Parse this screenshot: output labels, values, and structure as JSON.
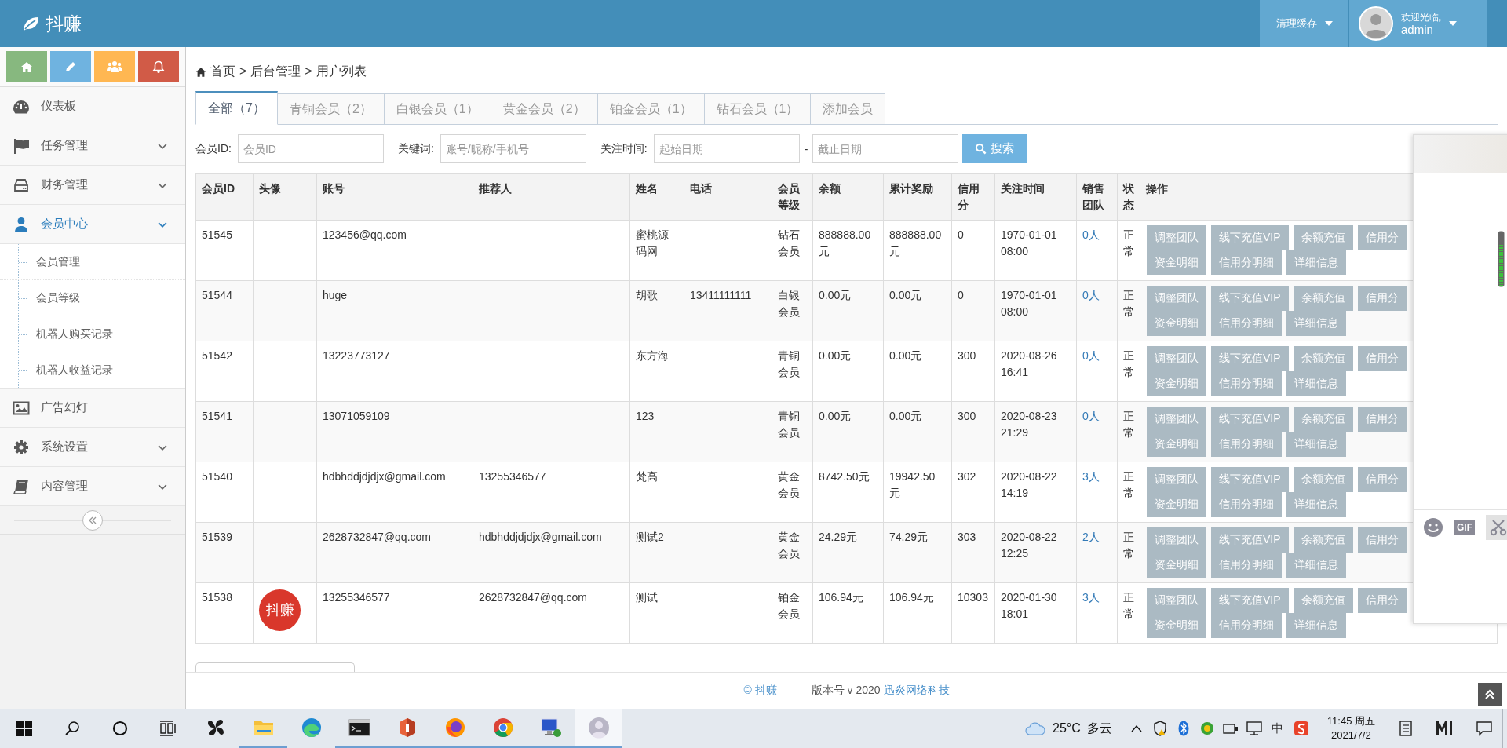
{
  "header": {
    "logo": "抖赚",
    "clear_cache": "清理缓存",
    "welcome": "欢迎光临,",
    "username": "admin"
  },
  "sidebar": {
    "items": [
      {
        "label": "仪表板",
        "selected": false,
        "submenu": false
      },
      {
        "label": "任务管理",
        "selected": false,
        "submenu": true
      },
      {
        "label": "财务管理",
        "selected": false,
        "submenu": true
      },
      {
        "label": "会员中心",
        "selected": true,
        "submenu": true,
        "children": [
          {
            "label": "会员管理",
            "selected": false
          },
          {
            "label": "会员等级",
            "selected": false
          },
          {
            "label": "机器人购买记录",
            "selected": false
          },
          {
            "label": "机器人收益记录",
            "selected": false
          }
        ]
      },
      {
        "label": "广告幻灯",
        "selected": false,
        "submenu": false
      },
      {
        "label": "系统设置",
        "selected": false,
        "submenu": true
      },
      {
        "label": "内容管理",
        "selected": false,
        "submenu": true
      }
    ]
  },
  "breadcrumb": {
    "items": [
      "首页",
      "后台管理",
      "用户列表"
    ],
    "separators": [
      ">",
      ">"
    ]
  },
  "tabs": [
    {
      "label": "全部（7）",
      "selected": true
    },
    {
      "label": "青铜会员（2）",
      "selected": false
    },
    {
      "label": "白银会员（1）",
      "selected": false
    },
    {
      "label": "黄金会员（2）",
      "selected": false
    },
    {
      "label": "铂金会员（1）",
      "selected": false
    },
    {
      "label": "钻石会员（1）",
      "selected": false
    },
    {
      "label": "添加会员",
      "selected": false
    }
  ],
  "filters": {
    "member_id": {
      "label": "会员ID:",
      "placeholder": "会员ID"
    },
    "keyword": {
      "label": "关键词:",
      "placeholder": "账号/昵称/手机号"
    },
    "follow_time": {
      "label": "关注时间:",
      "start_placeholder": "起始日期",
      "separator": "-",
      "end_placeholder": "截止日期"
    },
    "search_button": "搜索"
  },
  "table": {
    "columns": [
      "会员ID",
      "头像",
      "账号",
      "推荐人",
      "姓名",
      "电话",
      "会员等级",
      "余额",
      "累计奖励",
      "信用分",
      "关注时间",
      "销售团队",
      "状态",
      "操作"
    ],
    "rows": [
      {
        "id": "51545",
        "account": "123456@qq.com",
        "name": "蜜桃源码网",
        "level": "钻石会员",
        "balance": "888888.00元",
        "reward": "888888.00元",
        "credit": "0",
        "follow_time": "1970-01-01 08:00",
        "team": "0人",
        "status": "正常",
        "actions": [
          [
            "调整团队",
            "线下充值VIP",
            "余额充值",
            "信用分"
          ],
          [
            "资金明细",
            "信用分明细",
            "详细信息"
          ]
        ]
      },
      {
        "id": "51544",
        "account": "huge",
        "name": "胡歌",
        "phone": "13411111111",
        "level": "白银会员",
        "balance": "0.00元",
        "reward": "0.00元",
        "credit": "0",
        "follow_time": "1970-01-01 08:00",
        "team": "0人",
        "status": "正常",
        "actions": [
          [
            "调整团队",
            "线下充值VIP",
            "余额充值",
            "信用分"
          ],
          [
            "资金明细",
            "信用分明细",
            "详细信息"
          ]
        ]
      },
      {
        "id": "51542",
        "account": "13223773127",
        "name": "东方海",
        "level": "青铜会员",
        "balance": "0.00元",
        "reward": "0.00元",
        "credit": "300",
        "follow_time": "2020-08-26 16:41",
        "team": "0人",
        "status": "正常",
        "actions": [
          [
            "调整团队",
            "线下充值VIP",
            "余额充值",
            "信用分"
          ],
          [
            "资金明细",
            "信用分明细",
            "详细信息"
          ]
        ]
      },
      {
        "id": "51541",
        "account": "13071059109",
        "name": "123",
        "level": "青铜会员",
        "balance": "0.00元",
        "reward": "0.00元",
        "credit": "300",
        "follow_time": "2020-08-23 21:29",
        "team": "0人",
        "status": "正常",
        "actions": [
          [
            "调整团队",
            "线下充值VIP",
            "余额充值",
            "信用分"
          ],
          [
            "资金明细",
            "信用分明细",
            "详细信息"
          ]
        ]
      },
      {
        "id": "51540",
        "account": "hdbhddjdjdjx@gmail.com",
        "referrer": "13255346577",
        "name": "梵高",
        "level": "黄金会员",
        "balance": "8742.50元",
        "reward": "19942.50元",
        "credit": "302",
        "follow_time": "2020-08-22 14:19",
        "team": "3人",
        "status": "正常",
        "actions": [
          [
            "调整团队",
            "线下充值VIP",
            "余额充值",
            "信用分"
          ],
          [
            "资金明细",
            "信用分明细",
            "详细信息"
          ]
        ]
      },
      {
        "id": "51539",
        "account": "2628732847@qq.com",
        "referrer": "hdbhddjdjdjx@gmail.com",
        "name": "测试2",
        "level": "黄金会员",
        "balance": "24.29元",
        "reward": "74.29元",
        "credit": "303",
        "follow_time": "2020-08-22 12:25",
        "team": "2人",
        "status": "正常",
        "actions": [
          [
            "调整团队",
            "线下充值VIP",
            "余额充值",
            "信用分"
          ],
          [
            "资金明细",
            "信用分明细",
            "详细信息"
          ]
        ]
      },
      {
        "id": "51538",
        "avatar": "抖赚",
        "account": "13255346577",
        "referrer": "2628732847@qq.com",
        "name": "测试",
        "level": "铂金会员",
        "balance": "106.94元",
        "reward": "106.94元",
        "credit": "10303",
        "follow_time": "2020-01-30 18:01",
        "team": "3人",
        "status": "正常",
        "actions": [
          [
            "调整团队",
            "线下充值VIP",
            "余额充值",
            "信用分"
          ],
          [
            "资金明细",
            "信用分明细",
            "详细信息"
          ]
        ]
      }
    ]
  },
  "footer": {
    "copyright": "© 抖赚",
    "version": "版本号 v 2020",
    "company": "迅炎网络科技"
  },
  "chat_panel": {
    "gif": "GIF"
  },
  "taskbar": {
    "apps": [
      {
        "running": false,
        "active": false
      },
      {
        "running": true,
        "active": false
      },
      {
        "running": false,
        "active": false
      },
      {
        "running": true,
        "active": false
      },
      {
        "running": true,
        "active": false
      },
      {
        "running": true,
        "active": false
      },
      {
        "running": true,
        "active": false
      },
      {
        "running": true,
        "active": false
      },
      {
        "running": true,
        "active": true
      }
    ],
    "weather": {
      "temperature": "25°C",
      "condition": "多云"
    },
    "ime": "中",
    "time": "11:45 周五",
    "date": "2021/7/2"
  }
}
